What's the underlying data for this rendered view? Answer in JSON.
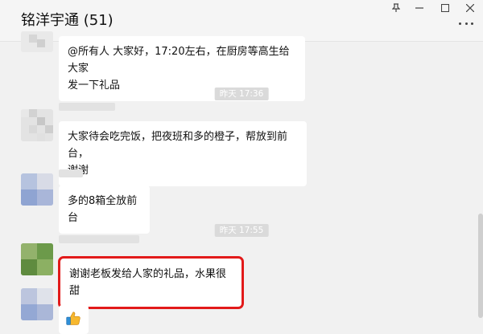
{
  "window": {
    "title": "铭洋宇通 (51)",
    "controls": {
      "pin": "⊤",
      "minimize": "—",
      "maximize": "☐",
      "close": "✕"
    }
  },
  "messages": [
    {
      "id": "m1",
      "text_line1": "@所有人 大家好，17:20左右，在厨房等高生给大家",
      "text_line2": "发一下礼品"
    },
    {
      "id": "m2",
      "text_line1": "大家待会吃完饭，把夜班和多的橙子，帮放到前台，",
      "text_line2": "谢谢"
    },
    {
      "id": "m3",
      "text_line1": "多的8箱全放前台"
    },
    {
      "id": "m4",
      "text_line1": "谢谢老板发给人家的礼品，水果很甜"
    },
    {
      "id": "m5",
      "emoji": "thumbs-up"
    }
  ],
  "timestamps": [
    {
      "id": "t1",
      "text": "昨天 17:36"
    },
    {
      "id": "t2",
      "text": "昨天 17:55"
    }
  ],
  "colors": {
    "highlight": "#e21a1a",
    "background": "#f1f1f1",
    "bubble": "#ffffff"
  }
}
